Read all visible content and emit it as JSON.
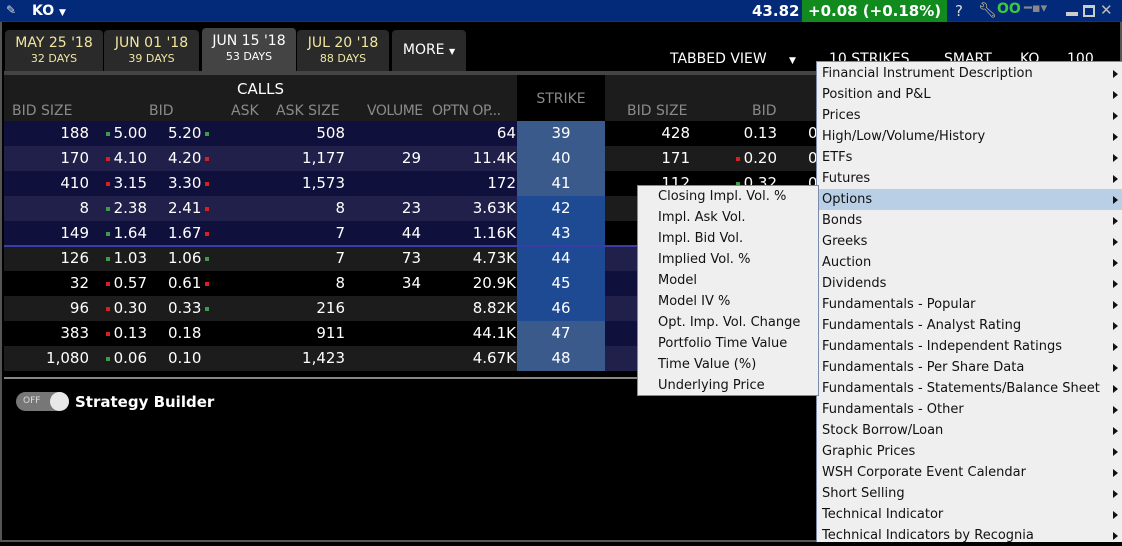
{
  "titlebar": {
    "symbol": "KO",
    "price": "43.82",
    "change": "+0.08 (+0.18%)",
    "help": "?"
  },
  "colors": {
    "title_bg": "#022a78",
    "change_bg": "#118a1e",
    "up_tick": "#3f9a4a",
    "down_tick": "#d82020",
    "menu_highlight": "#b8cfe6"
  },
  "tabs": [
    {
      "date": "MAY 25 '18",
      "days": "32 DAYS"
    },
    {
      "date": "JUN 01 '18",
      "days": "39 DAYS"
    },
    {
      "date": "JUN 15 '18",
      "days": "53 DAYS",
      "active": true
    },
    {
      "date": "JUL 20 '18",
      "days": "88 DAYS"
    }
  ],
  "more_label": "MORE",
  "toolbar": {
    "view": "TABBED VIEW",
    "strikes": "10 STRIKES",
    "exchange": "SMART",
    "underlying": "KO",
    "multiplier": "100"
  },
  "calls": {
    "title": "CALLS",
    "columns": [
      "BID SIZE",
      "BID",
      "ASK",
      "ASK SIZE",
      "VOLUME",
      "OPTN OP..."
    ]
  },
  "strike_header": "STRIKE",
  "puts": {
    "columns": [
      "BID SIZE",
      "BID"
    ]
  },
  "rows": [
    {
      "strike": "39",
      "bid_size": "188",
      "bid": "5.00",
      "bid_tick": "up",
      "ask": "5.20",
      "ask_tick": "up",
      "ask_size": "508",
      "volume": "",
      "oi": "64",
      "put_bid_size": "428",
      "put_bid": "0.13",
      "put_bid_tick": "",
      "put_next": "0"
    },
    {
      "strike": "40",
      "bid_size": "170",
      "bid": "4.10",
      "bid_tick": "down",
      "ask": "4.20",
      "ask_tick": "down",
      "ask_size": "1,177",
      "volume": "29",
      "oi": "11.4K",
      "put_bid_size": "171",
      "put_bid": "0.20",
      "put_bid_tick": "down",
      "put_next": "0"
    },
    {
      "strike": "41",
      "bid_size": "410",
      "bid": "3.15",
      "bid_tick": "down",
      "ask": "3.30",
      "ask_tick": "down",
      "ask_size": "1,573",
      "volume": "",
      "oi": "172",
      "put_bid_size": "112",
      "put_bid": "0.32",
      "put_bid_tick": "up",
      "put_next": "0"
    },
    {
      "strike": "42",
      "bid_size": "8",
      "bid": "2.38",
      "bid_tick": "up",
      "ask": "2.41",
      "ask_tick": "down",
      "ask_size": "8",
      "volume": "23",
      "oi": "3.63K"
    },
    {
      "strike": "43",
      "bid_size": "149",
      "bid": "1.64",
      "bid_tick": "up",
      "ask": "1.67",
      "ask_tick": "down",
      "ask_size": "7",
      "volume": "44",
      "oi": "1.16K"
    },
    {
      "strike": "44",
      "bid_size": "126",
      "bid": "1.03",
      "bid_tick": "up",
      "ask": "1.06",
      "ask_tick": "up",
      "ask_size": "7",
      "volume": "73",
      "oi": "4.73K"
    },
    {
      "strike": "45",
      "bid_size": "32",
      "bid": "0.57",
      "bid_tick": "down",
      "ask": "0.61",
      "ask_tick": "down",
      "ask_size": "8",
      "volume": "34",
      "oi": "20.9K"
    },
    {
      "strike": "46",
      "bid_size": "96",
      "bid": "0.30",
      "bid_tick": "down",
      "ask": "0.33",
      "ask_tick": "up",
      "ask_size": "216",
      "volume": "",
      "oi": "8.82K"
    },
    {
      "strike": "47",
      "bid_size": "383",
      "bid": "0.13",
      "bid_tick": "down",
      "ask": "0.18",
      "ask_tick": "",
      "ask_size": "911",
      "volume": "",
      "oi": "44.1K"
    },
    {
      "strike": "48",
      "bid_size": "1,080",
      "bid": "0.06",
      "bid_tick": "up",
      "ask": "0.10",
      "ask_tick": "",
      "ask_size": "1,423",
      "volume": "",
      "oi": "4.67K"
    }
  ],
  "strategy_builder": {
    "toggle": "OFF",
    "label": "Strategy Builder"
  },
  "context_menu": [
    "Financial Instrument Description",
    "Position and P&L",
    "Prices",
    "High/Low/Volume/History",
    "ETFs",
    "Futures",
    "Options",
    "Bonds",
    "Greeks",
    "Auction",
    "Dividends",
    "Fundamentals - Popular",
    "Fundamentals - Analyst Rating",
    "Fundamentals - Independent Ratings",
    "Fundamentals - Per Share Data",
    "Fundamentals - Statements/Balance Sheet",
    "Fundamentals - Other",
    "Stock Borrow/Loan",
    "Graphic Prices",
    "WSH Corporate Event Calendar",
    "Short Selling",
    "Technical Indicator",
    "Technical Indicators by Recognia"
  ],
  "context_menu_highlighted": "Options",
  "options_submenu": [
    "Closing Impl. Vol. %",
    "Impl. Ask Vol.",
    "Impl. Bid Vol.",
    "Implied Vol. %",
    "Model",
    "Model IV %",
    "Opt. Imp. Vol. Change",
    "Portfolio Time Value",
    "Time Value (%)",
    "Underlying Price"
  ]
}
